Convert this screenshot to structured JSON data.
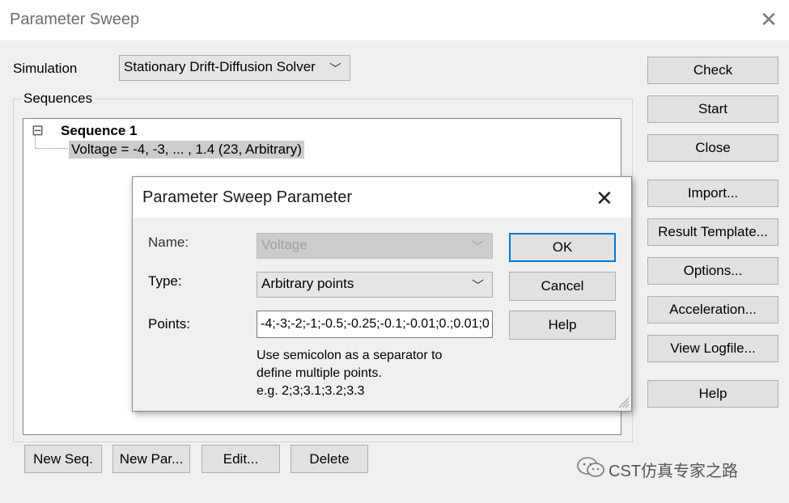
{
  "window": {
    "title": "Parameter Sweep",
    "close_glyph": "✕"
  },
  "simulation": {
    "label": "Simulation",
    "value": "Stationary Drift-Diffusion Solver",
    "chevron": "﹀"
  },
  "sequences": {
    "label": "Sequences",
    "tree": {
      "expander": "⊟",
      "sequence_label": "Sequence 1",
      "parameter_label": "Voltage = -4, -3, ... , 1.4 (23, Arbitrary)"
    }
  },
  "side_buttons": {
    "check": "Check",
    "start": "Start",
    "close": "Close",
    "import": "Import...",
    "result_template": "Result Template...",
    "options": "Options...",
    "acceleration": "Acceleration...",
    "view_logfile": "View Logfile...",
    "help": "Help"
  },
  "bottom_buttons": {
    "new_seq": "New Seq.",
    "new_par": "New Par...",
    "edit": "Edit...",
    "delete": "Delete"
  },
  "dialog": {
    "title": "Parameter Sweep Parameter",
    "close_glyph": "✕",
    "name_label": "Name:",
    "name_value": "Voltage",
    "type_label": "Type:",
    "type_value": "Arbitrary points",
    "points_label": "Points:",
    "points_value": "-4;-3;-2;-1;-0.5;-0.25;-0.1;-0.01;0.;0.01;0",
    "hint_line1": "Use semicolon as a separator to",
    "hint_line2": "define multiple points.",
    "hint_line3": "e.g. 2;3;3.1;3.2;3.3",
    "ok": "OK",
    "cancel": "Cancel",
    "help": "Help"
  },
  "watermark": {
    "text": "CST仿真专家之路",
    "icon": "wechat-icon"
  },
  "colors": {
    "accent": "#0078d7",
    "selection": "#cccccc",
    "disabled_text": "#a0a0a0"
  }
}
